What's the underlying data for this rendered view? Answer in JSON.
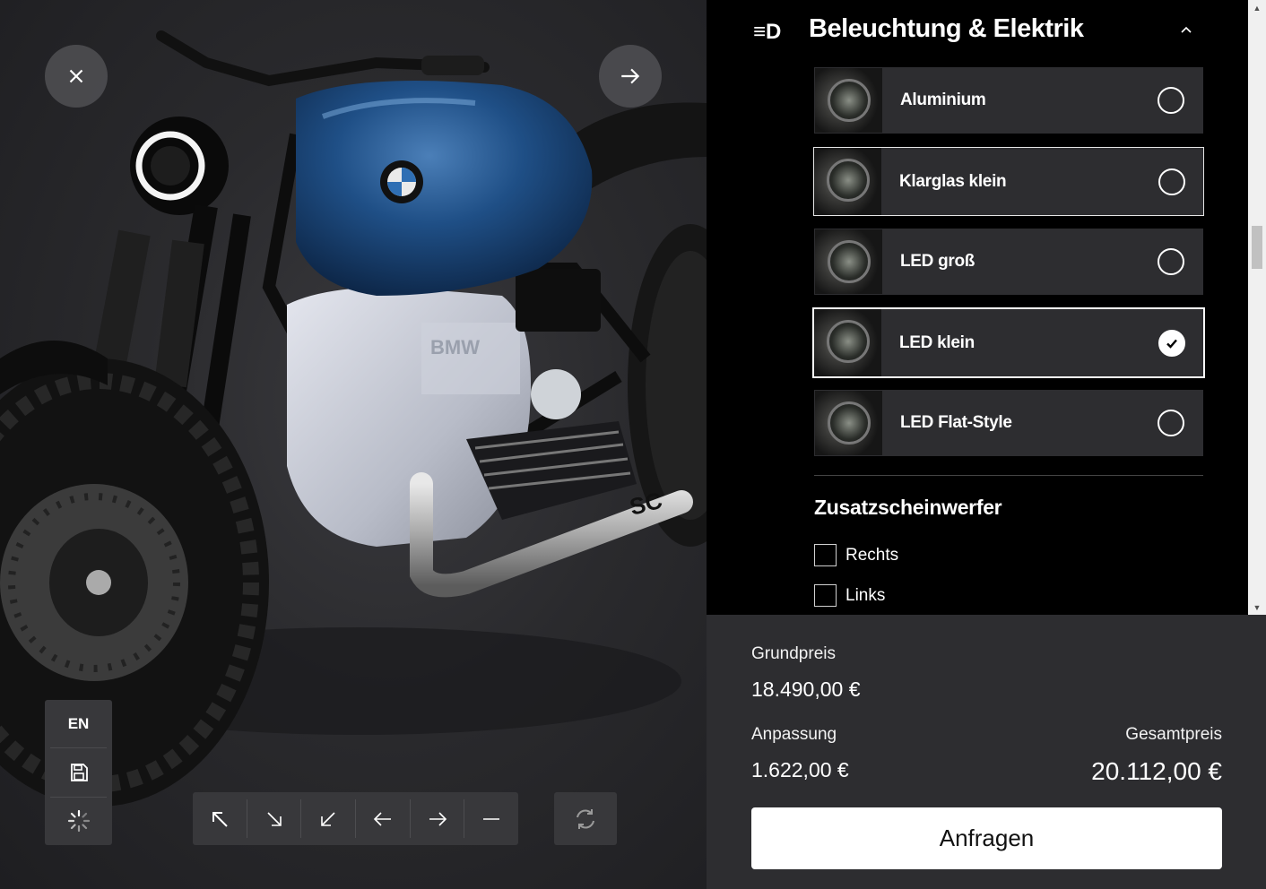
{
  "viewer": {
    "close_icon": "close-icon",
    "next_icon": "arrow-right-icon",
    "side_tools": {
      "language": "EN",
      "save_icon": "save-icon",
      "loading_icon": "spinner-icon"
    },
    "view_buttons": [
      "arrow-up-left-icon",
      "arrow-down-right-icon",
      "arrow-down-left-icon",
      "arrow-left-icon",
      "arrow-right-icon",
      "minus-icon"
    ],
    "reset_icon": "refresh-icon"
  },
  "config": {
    "section": {
      "title": "Beleuchtung & Elektrik",
      "icon": "headlight-icon",
      "collapse_icon": "chevron-up-icon"
    },
    "options": [
      {
        "label": "Aluminium",
        "selected": false
      },
      {
        "label": "Klarglas klein",
        "selected": false
      },
      {
        "label": "LED groß",
        "selected": false
      },
      {
        "label": "LED klein",
        "selected": true
      },
      {
        "label": "LED Flat-Style",
        "selected": false
      }
    ],
    "subsection": {
      "title": "Zusatzscheinwerfer",
      "checkboxes": [
        {
          "label": "Rechts",
          "checked": false
        },
        {
          "label": "Links",
          "checked": false
        }
      ]
    }
  },
  "pricing": {
    "base_label": "Grundpreis",
    "base_value": "18.490,00 €",
    "custom_label": "Anpassung",
    "custom_value": "1.622,00 €",
    "total_label": "Gesamtpreis",
    "total_value": "20.112,00 €",
    "request_label": "Anfragen"
  },
  "colors": {
    "tank_blue": "#1f4f86",
    "panel_dark": "#2d2d30",
    "accent_white": "#ffffff"
  }
}
